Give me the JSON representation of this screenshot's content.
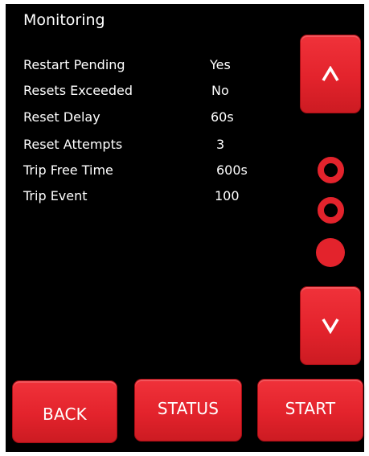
{
  "screen": {
    "title": "Monitoring"
  },
  "params": [
    {
      "label": "Restart Pending",
      "value": "Yes"
    },
    {
      "label": "Resets Exceeded",
      "value": "No"
    },
    {
      "label": "Reset Delay",
      "value": "60s"
    },
    {
      "label": "Reset Attempts",
      "value": "3"
    },
    {
      "label": "Trip Free Time",
      "value": "600s"
    },
    {
      "label": "Trip Event",
      "value": "100"
    }
  ],
  "nav": {
    "up_icon": "chevron-up-icon",
    "down_icon": "chevron-down-icon"
  },
  "pager": {
    "pages": [
      {
        "state": "inactive"
      },
      {
        "state": "inactive"
      },
      {
        "state": "active"
      }
    ]
  },
  "footer": {
    "back_label": "BACK",
    "status_label": "STATUS",
    "start_label": "START"
  },
  "colors": {
    "background": "#000000",
    "accent": "#e3232c",
    "text": "#ffffff"
  }
}
